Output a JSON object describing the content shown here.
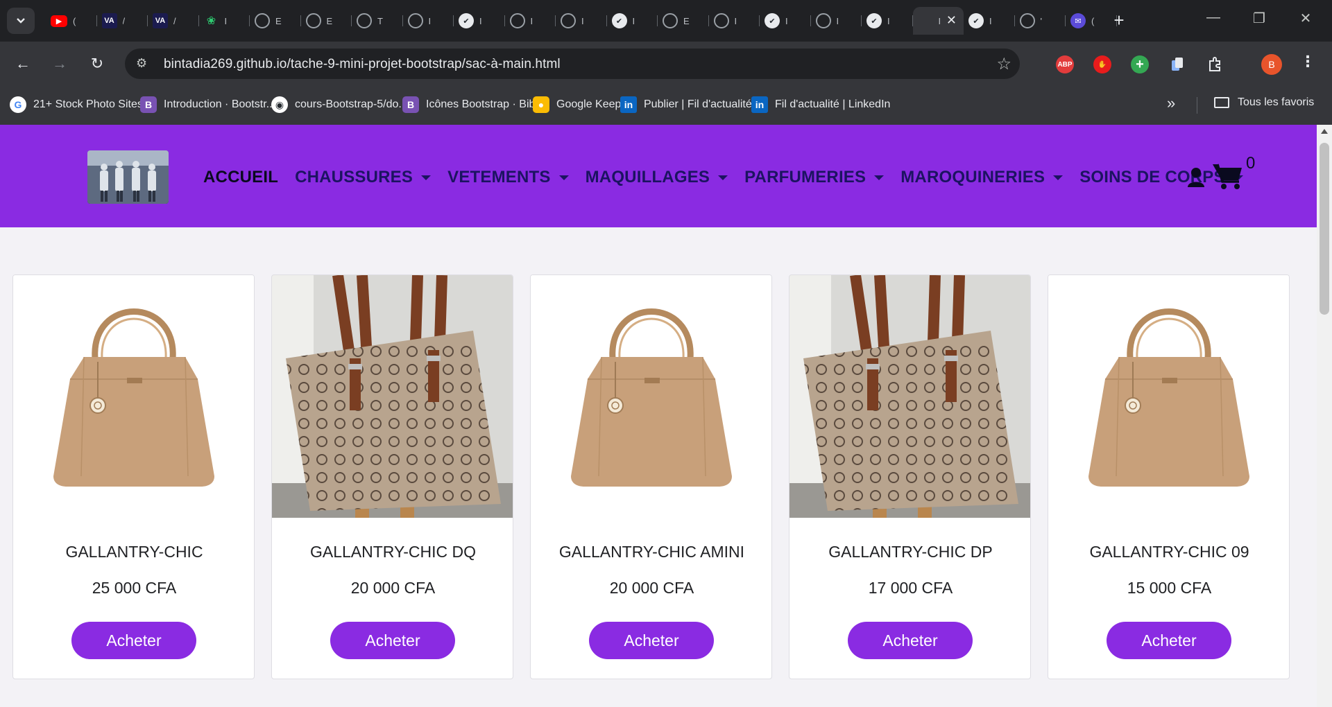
{
  "browser": {
    "tabs": [
      {
        "icon": "youtube-icon",
        "label": "("
      },
      {
        "icon": "va-icon",
        "label": "/"
      },
      {
        "icon": "va-icon",
        "label": "/"
      },
      {
        "icon": "leaf-icon",
        "label": "I"
      },
      {
        "icon": "globe-icon",
        "label": "E"
      },
      {
        "icon": "globe-icon",
        "label": "E"
      },
      {
        "icon": "globe-icon",
        "label": "T"
      },
      {
        "icon": "globe-icon",
        "label": "I"
      },
      {
        "icon": "github-icon",
        "label": "I"
      },
      {
        "icon": "globe-icon",
        "label": "I"
      },
      {
        "icon": "globe-icon",
        "label": "I"
      },
      {
        "icon": "github-icon",
        "label": "I"
      },
      {
        "icon": "globe-icon",
        "label": "E"
      },
      {
        "icon": "globe-icon",
        "label": "I"
      },
      {
        "icon": "github-icon",
        "label": "I"
      },
      {
        "icon": "globe-icon",
        "label": "I"
      },
      {
        "icon": "github-icon",
        "label": "I"
      },
      {
        "icon": "active",
        "label": "I"
      },
      {
        "icon": "github-icon",
        "label": "I"
      },
      {
        "icon": "globe-icon",
        "label": "'"
      },
      {
        "icon": "mail-icon",
        "label": "("
      }
    ],
    "url": "bintadia269.github.io/tache-9-mini-projet-bootstrap/sac-à-main.html",
    "extensions": {
      "abp": "ABP"
    },
    "profile_initial": "B",
    "bookmarks": [
      {
        "icon": "G",
        "label": "21+ Stock Photo Sites..."
      },
      {
        "icon": "B",
        "label": "Introduction · Bootstr..."
      },
      {
        "icon": "gh",
        "label": "cours-Bootstrap-5/do..."
      },
      {
        "icon": "B",
        "label": "Icônes Bootstrap · Bibl..."
      },
      {
        "icon": "keep",
        "label": "Google Keep"
      },
      {
        "icon": "in",
        "label": "Publier | Fil d'actualité..."
      },
      {
        "icon": "in",
        "label": "Fil d'actualité | LinkedIn"
      }
    ],
    "all_bookmarks": "Tous les favoris"
  },
  "site": {
    "nav": [
      {
        "label": "ACCUEIL",
        "dropdown": false
      },
      {
        "label": "CHAUSSURES",
        "dropdown": true
      },
      {
        "label": "VETEMENTS",
        "dropdown": true
      },
      {
        "label": "MAQUILLAGES",
        "dropdown": true
      },
      {
        "label": "PARFUMERIES",
        "dropdown": true
      },
      {
        "label": "MAROQUINERIES",
        "dropdown": true
      },
      {
        "label": "SOINS DE CORPS",
        "dropdown": true
      }
    ],
    "cart_count": "0",
    "accent": "#8a2be2",
    "products": [
      {
        "name": "GALLANTRY-CHIC",
        "price": "25 000 CFA",
        "button": "Acheter",
        "image": "tan-handbag"
      },
      {
        "name": "GALLANTRY-CHIC DQ",
        "price": "20 000 CFA",
        "button": "Acheter",
        "image": "monogram-tote"
      },
      {
        "name": "GALLANTRY-CHIC AMINI",
        "price": "20 000 CFA",
        "button": "Acheter",
        "image": "tan-handbag"
      },
      {
        "name": "GALLANTRY-CHIC DP",
        "price": "17 000 CFA",
        "button": "Acheter",
        "image": "monogram-tote"
      },
      {
        "name": "GALLANTRY-CHIC 09",
        "price": "15 000 CFA",
        "button": "Acheter",
        "image": "tan-handbag"
      }
    ]
  }
}
